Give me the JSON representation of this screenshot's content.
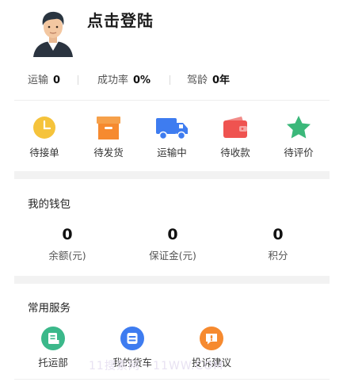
{
  "profile": {
    "login_text": "点击登陆",
    "stats": [
      {
        "label": "运输",
        "value": "0"
      },
      {
        "label": "成功率",
        "value": "0%"
      },
      {
        "label": "驾龄",
        "value": "0年"
      }
    ]
  },
  "orders": {
    "items": [
      {
        "label": "待接单",
        "icon": "clock-icon",
        "color": "#f5c33b"
      },
      {
        "label": "待发货",
        "icon": "box-icon",
        "color": "#f68a2f"
      },
      {
        "label": "运输中",
        "icon": "truck-icon",
        "color": "#3e7cf0"
      },
      {
        "label": "待收款",
        "icon": "wallet-icon",
        "color": "#ef5350"
      },
      {
        "label": "待评价",
        "icon": "star-icon",
        "color": "#3bb87a"
      }
    ]
  },
  "wallet": {
    "title": "我的钱包",
    "items": [
      {
        "value": "0",
        "label": "余额(元)"
      },
      {
        "value": "0",
        "label": "保证金(元)"
      },
      {
        "value": "0",
        "label": "积分"
      }
    ]
  },
  "services": {
    "title": "常用服务",
    "items": [
      {
        "label": "托运部",
        "icon": "depot-icon",
        "color": "#3bb88a"
      },
      {
        "label": "我的货车",
        "icon": "my-truck-icon",
        "color": "#3e7cf0"
      },
      {
        "label": "投诉建议",
        "icon": "feedback-icon",
        "color": "#f68a2f"
      }
    ]
  },
  "watermark": "11搜索网 · 11WW.COM"
}
